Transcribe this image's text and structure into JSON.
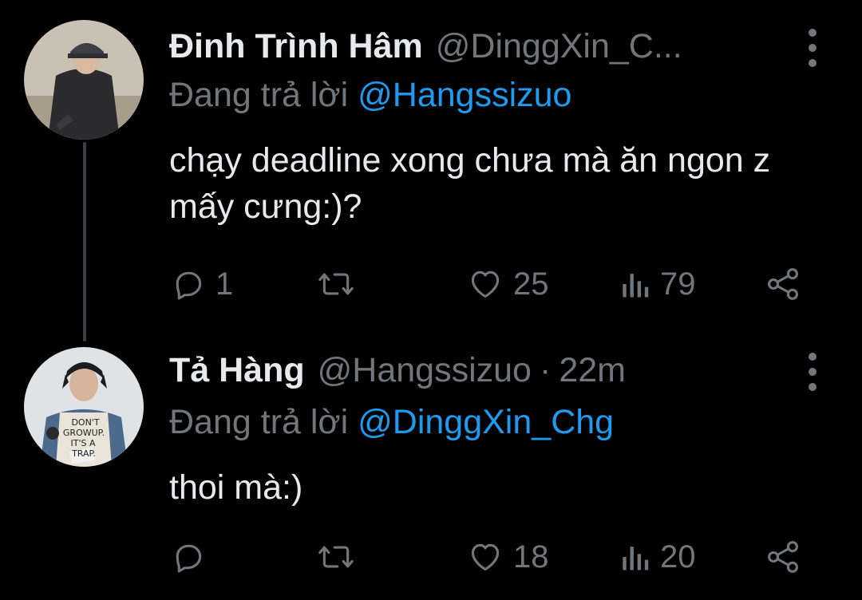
{
  "theme": {
    "background": "#000000",
    "text": "#e7e9ea",
    "muted": "#71767b",
    "accent": "#1d9bf0"
  },
  "tweets": [
    {
      "name": "Đinh Trình Hâm",
      "handle": "@DinggXin_C...",
      "time": "",
      "reply_prefix": "Đang trả lời ",
      "reply_mention": "@Hangssizuo",
      "text": "chạy deadline xong chưa mà ăn ngon z mấy cưng:)?",
      "reply_count": "1",
      "retweet_count": "",
      "like_count": "25",
      "view_count": "79",
      "icons": [
        "reply-icon",
        "retweet-icon",
        "like-icon",
        "views-icon",
        "share-icon"
      ]
    },
    {
      "name": "Tả Hàng",
      "handle": "@Hangssizuo",
      "separator": "·",
      "time": "22m",
      "reply_prefix": "Đang trả lời ",
      "reply_mention": "@DinggXin_Chg",
      "text": "thoi mà:)",
      "reply_count": "",
      "retweet_count": "",
      "like_count": "18",
      "view_count": "20",
      "avatar_shirt_text": [
        "DON'T",
        "GROWUP.",
        "IT'S A",
        "TRAP."
      ],
      "icons": [
        "reply-icon",
        "retweet-icon",
        "like-icon",
        "views-icon",
        "share-icon"
      ]
    }
  ]
}
